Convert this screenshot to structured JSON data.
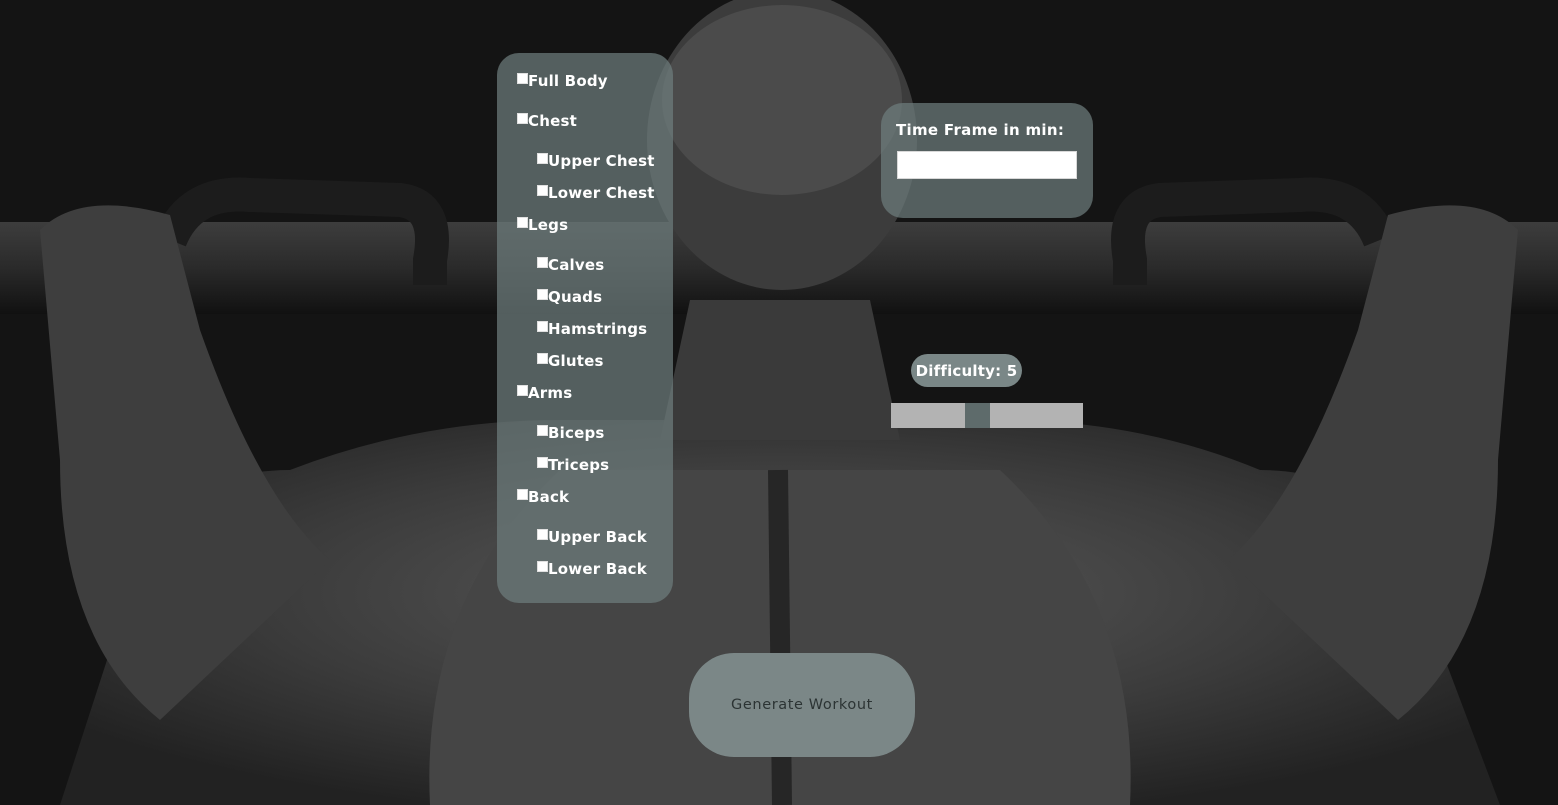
{
  "muscle_groups": [
    {
      "label": "Full Body",
      "checked": false
    },
    {
      "label": "Chest",
      "checked": false,
      "subgroups": [
        {
          "label": "Upper Chest",
          "checked": false
        },
        {
          "label": "Lower Chest",
          "checked": false
        }
      ]
    },
    {
      "label": "Legs",
      "checked": false,
      "subgroups": [
        {
          "label": "Calves",
          "checked": false
        },
        {
          "label": "Quads",
          "checked": false
        },
        {
          "label": "Hamstrings",
          "checked": false
        },
        {
          "label": "Glutes",
          "checked": false
        }
      ]
    },
    {
      "label": "Arms",
      "checked": false,
      "subgroups": [
        {
          "label": "Biceps",
          "checked": false
        },
        {
          "label": "Triceps",
          "checked": false
        }
      ]
    },
    {
      "label": "Back",
      "checked": false,
      "subgroups": [
        {
          "label": "Upper Back",
          "checked": false
        },
        {
          "label": "Lower Back",
          "checked": false
        }
      ]
    }
  ],
  "time_frame": {
    "label": "Time Frame in min:",
    "value": ""
  },
  "difficulty": {
    "label": "Difficulty: 5",
    "value": 5,
    "min": 1,
    "max": 10
  },
  "generate_button": {
    "label": "Generate Workout"
  },
  "colors": {
    "panel": "#6e7d7d",
    "button": "#7b8787",
    "slider_track": "#b3b3b3",
    "slider_thumb": "#5e6b6b"
  },
  "background_image": "grayscale-photo-man-back-pull-up-bar"
}
